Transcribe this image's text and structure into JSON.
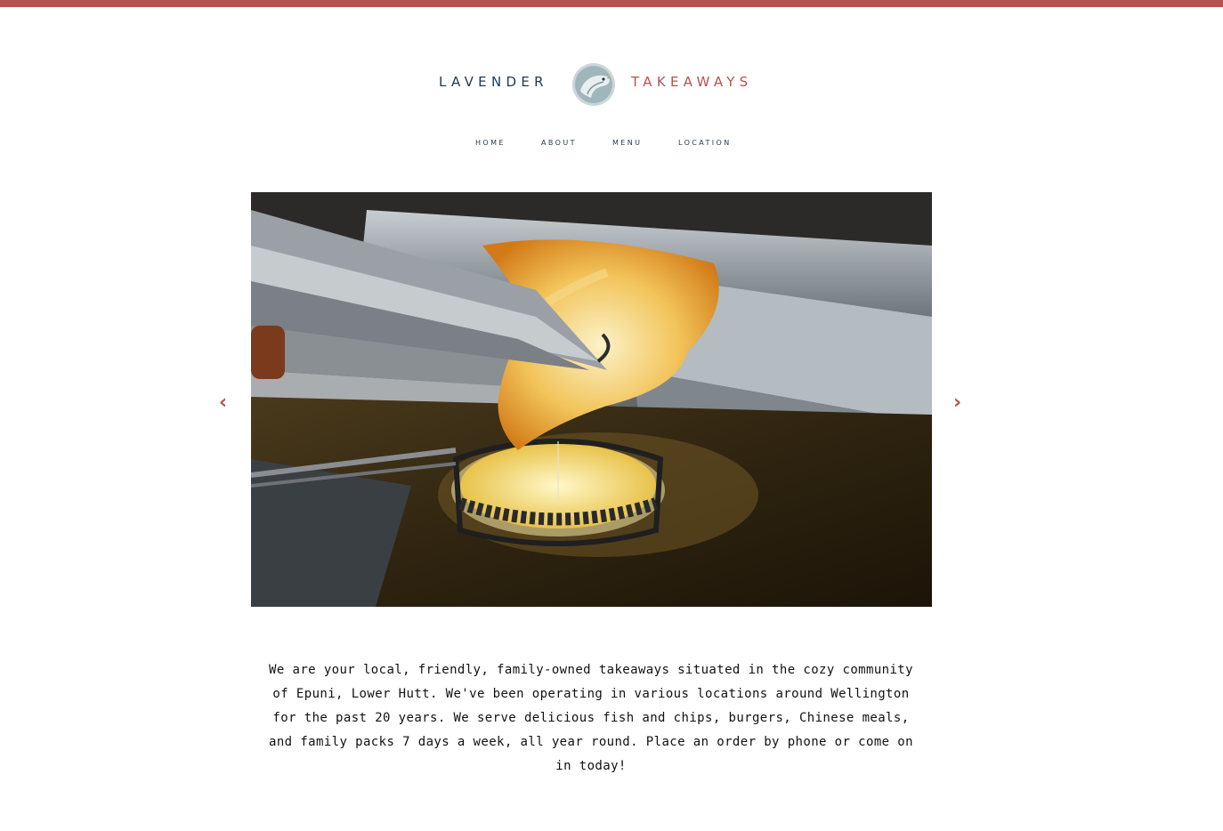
{
  "colors": {
    "accent": "#b5524d",
    "navy": "#1f3a4f"
  },
  "brand": {
    "left_word": "LAVENDER",
    "right_word": "TAKEAWAYS",
    "logo_icon": "fish-circle-logo-icon"
  },
  "nav": {
    "items": [
      {
        "label": "HOME"
      },
      {
        "label": "ABOUT"
      },
      {
        "label": "MENU"
      },
      {
        "label": "LOCATION"
      }
    ]
  },
  "carousel": {
    "prev_label": "‹",
    "next_label": "›",
    "image_subject": "battered-fish-frying-photo"
  },
  "intro": {
    "text": "We are your local, friendly, family-owned takeaways situated in the cozy community of Epuni, Lower Hutt. We've been operating in various locations around Wellington for the past 20 years. We serve delicious fish and chips, burgers, Chinese meals, and family packs 7 days a week, all year round. Place an order by phone or come on in today!"
  }
}
